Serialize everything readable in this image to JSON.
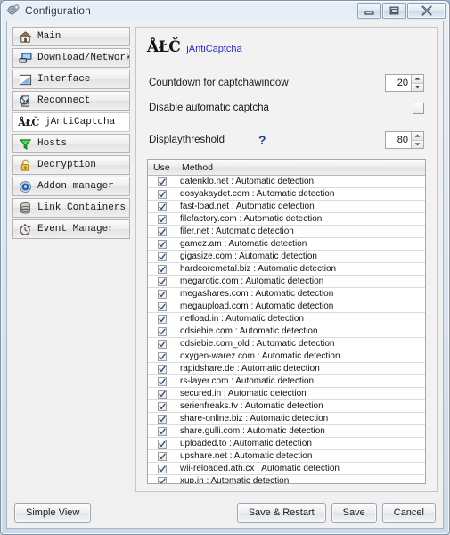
{
  "window": {
    "title": "Configuration",
    "icon": "gear-icon",
    "controls": {
      "minimize": "Minimize",
      "maximize": "Maximize",
      "close": "Close"
    }
  },
  "sidebar": {
    "items": [
      {
        "label": "Main",
        "icon": "home-icon",
        "active": false
      },
      {
        "label": "Download/Network",
        "icon": "network-icon",
        "active": false
      },
      {
        "label": "Interface",
        "icon": "window-icon",
        "active": false
      },
      {
        "label": "Reconnect",
        "icon": "hourglass-icon",
        "active": false
      },
      {
        "label": "jAntiCaptcha",
        "icon": "alc-text-icon",
        "icon_text": "ÅŁČ",
        "active": true
      },
      {
        "label": "Hosts",
        "icon": "funnel-icon",
        "active": false
      },
      {
        "label": "Decryption",
        "icon": "padlock-icon",
        "active": false
      },
      {
        "label": "Addon manager",
        "icon": "addon-disc-icon",
        "active": false
      },
      {
        "label": "Link Containers",
        "icon": "database-icon",
        "active": false
      },
      {
        "label": "Event Manager",
        "icon": "stopwatch-icon",
        "active": false
      }
    ]
  },
  "main": {
    "brand_logo": "ÅŁČ",
    "brand_link": "jAntiCaptcha",
    "settings": {
      "countdown_label": "Countdown for captchawindow",
      "countdown_value": "20",
      "disable_auto_label": "Disable automatic captcha",
      "disable_auto_checked": false,
      "threshold_label": "Displaythreshold",
      "threshold_help": "?",
      "threshold_value": "80"
    },
    "table": {
      "columns": [
        "Use",
        "Method"
      ],
      "rows": [
        {
          "use": true,
          "method": "datenklo.net : Automatic detection"
        },
        {
          "use": true,
          "method": "dosyakaydet.com : Automatic detection"
        },
        {
          "use": true,
          "method": "fast-load.net : Automatic detection"
        },
        {
          "use": true,
          "method": "filefactory.com : Automatic detection"
        },
        {
          "use": true,
          "method": "filer.net : Automatic detection"
        },
        {
          "use": true,
          "method": "gamez.am : Automatic detection"
        },
        {
          "use": true,
          "method": "gigasize.com : Automatic detection"
        },
        {
          "use": true,
          "method": "hardcoremetal.biz : Automatic detection"
        },
        {
          "use": true,
          "method": "megarotic.com : Automatic detection"
        },
        {
          "use": true,
          "method": "megashares.com : Automatic detection"
        },
        {
          "use": true,
          "method": "megaupload.com : Automatic detection"
        },
        {
          "use": true,
          "method": "netload.in : Automatic detection"
        },
        {
          "use": true,
          "method": "odsiebie.com : Automatic detection"
        },
        {
          "use": true,
          "method": "odsiebie.com_old : Automatic detection"
        },
        {
          "use": true,
          "method": "oxygen-warez.com : Automatic detection"
        },
        {
          "use": true,
          "method": "rapidshare.de : Automatic detection"
        },
        {
          "use": true,
          "method": "rs-layer.com : Automatic detection"
        },
        {
          "use": true,
          "method": "secured.in : Automatic detection"
        },
        {
          "use": true,
          "method": "serienfreaks.tv : Automatic detection"
        },
        {
          "use": true,
          "method": "share-online.biz : Automatic detection"
        },
        {
          "use": true,
          "method": "share.gulli.com : Automatic detection"
        },
        {
          "use": true,
          "method": "uploaded.to : Automatic detection"
        },
        {
          "use": true,
          "method": "upshare.net : Automatic detection"
        },
        {
          "use": true,
          "method": "wii-reloaded.ath.cx : Automatic detection"
        },
        {
          "use": true,
          "method": "xup.in : Automatic detection"
        }
      ]
    }
  },
  "footer": {
    "simple_view": "Simple View",
    "save_restart": "Save & Restart",
    "save": "Save",
    "cancel": "Cancel"
  },
  "colors": {
    "link": "#2a2ad0",
    "help": "#1f3e86",
    "panel": "#f2f2f2",
    "selected_row": "#ffffff"
  }
}
